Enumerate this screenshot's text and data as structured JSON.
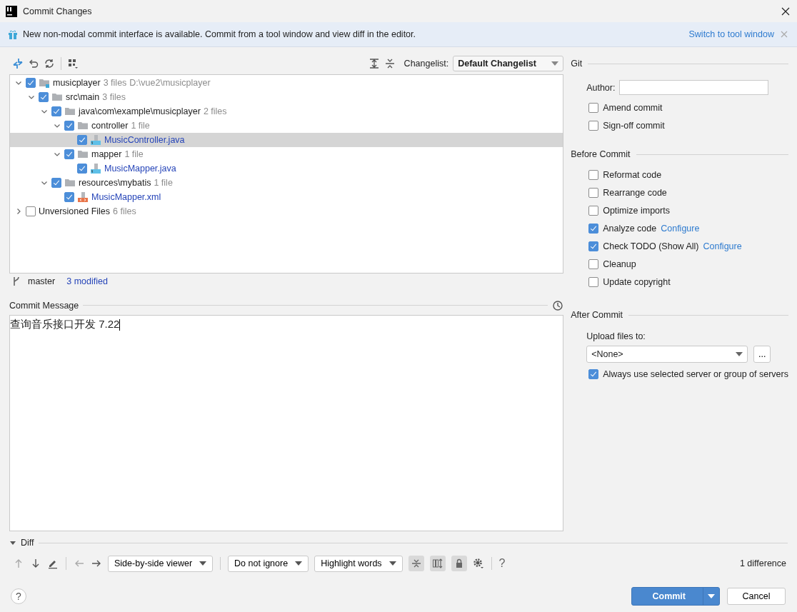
{
  "window": {
    "title": "Commit Changes"
  },
  "banner": {
    "text": "New non-modal commit interface is available. Commit from a tool window and view diff in the editor.",
    "link": "Switch to tool window"
  },
  "changelist": {
    "label": "Changelist:",
    "value": "Default Changelist"
  },
  "tree": [
    {
      "kind": "module",
      "name": "musicplayer",
      "count": "3 files",
      "path": "D:\\vue2\\musicplayer",
      "checked": true,
      "expanded": true,
      "selected": false,
      "children": [
        {
          "kind": "folder",
          "name": "src\\main",
          "count": "3 files",
          "checked": true,
          "expanded": true,
          "selected": false,
          "children": [
            {
              "kind": "folder",
              "name": "java\\com\\example\\musicplayer",
              "count": "2 files",
              "checked": true,
              "expanded": true,
              "selected": false,
              "children": [
                {
                  "kind": "folder",
                  "name": "controller",
                  "count": "1 file",
                  "checked": true,
                  "expanded": true,
                  "selected": false,
                  "children": [
                    {
                      "kind": "java",
                      "name": "MusicController.java",
                      "checked": true,
                      "selected": true
                    }
                  ]
                },
                {
                  "kind": "folder",
                  "name": "mapper",
                  "count": "1 file",
                  "checked": true,
                  "expanded": true,
                  "selected": false,
                  "children": [
                    {
                      "kind": "java",
                      "name": "MusicMapper.java",
                      "checked": true,
                      "selected": false
                    }
                  ]
                }
              ]
            },
            {
              "kind": "folder",
              "name": "resources\\mybatis",
              "count": "1 file",
              "checked": true,
              "expanded": true,
              "selected": false,
              "children": [
                {
                  "kind": "xml",
                  "name": "MusicMapper.xml",
                  "checked": true,
                  "selected": false
                }
              ]
            }
          ]
        }
      ]
    },
    {
      "kind": "group",
      "name": "Unversioned Files",
      "count": "6 files",
      "checked": false,
      "expanded": false,
      "selected": false
    }
  ],
  "status": {
    "branch": "master",
    "modified": "3 modified"
  },
  "commit_message": {
    "label": "Commit Message",
    "value": "查询音乐接口开发 7.22"
  },
  "git": {
    "title": "Git",
    "author_label": "Author:",
    "options": [
      {
        "label": "Amend commit",
        "checked": false
      },
      {
        "label": "Sign-off commit",
        "checked": false
      }
    ]
  },
  "before_commit": {
    "title": "Before Commit",
    "options": [
      {
        "label": "Reformat code",
        "checked": false
      },
      {
        "label": "Rearrange code",
        "checked": false
      },
      {
        "label": "Optimize imports",
        "checked": false
      },
      {
        "label": "Analyze code",
        "link": "Configure",
        "checked": true
      },
      {
        "label": "Check TODO (Show All)",
        "link": "Configure",
        "checked": true
      },
      {
        "label": "Cleanup",
        "checked": false
      },
      {
        "label": "Update copyright",
        "checked": false
      }
    ]
  },
  "after_commit": {
    "title": "After Commit",
    "upload_label": "Upload files to:",
    "upload_value": "<None>",
    "browse": "...",
    "options": [
      {
        "label": "Always use selected server or group of servers",
        "checked": true
      }
    ]
  },
  "diff": {
    "title": "Diff",
    "expanded": true,
    "dropdowns": [
      "Side-by-side viewer",
      "Do not ignore",
      "Highlight words"
    ],
    "toggles": [
      {
        "kind": "collapse",
        "on": true
      },
      {
        "kind": "sync",
        "on": true
      },
      {
        "kind": "lock",
        "on": true
      }
    ],
    "help": "?",
    "summary": "1 difference"
  },
  "footer": {
    "help": "?",
    "commit": "Commit",
    "cancel": "Cancel"
  }
}
